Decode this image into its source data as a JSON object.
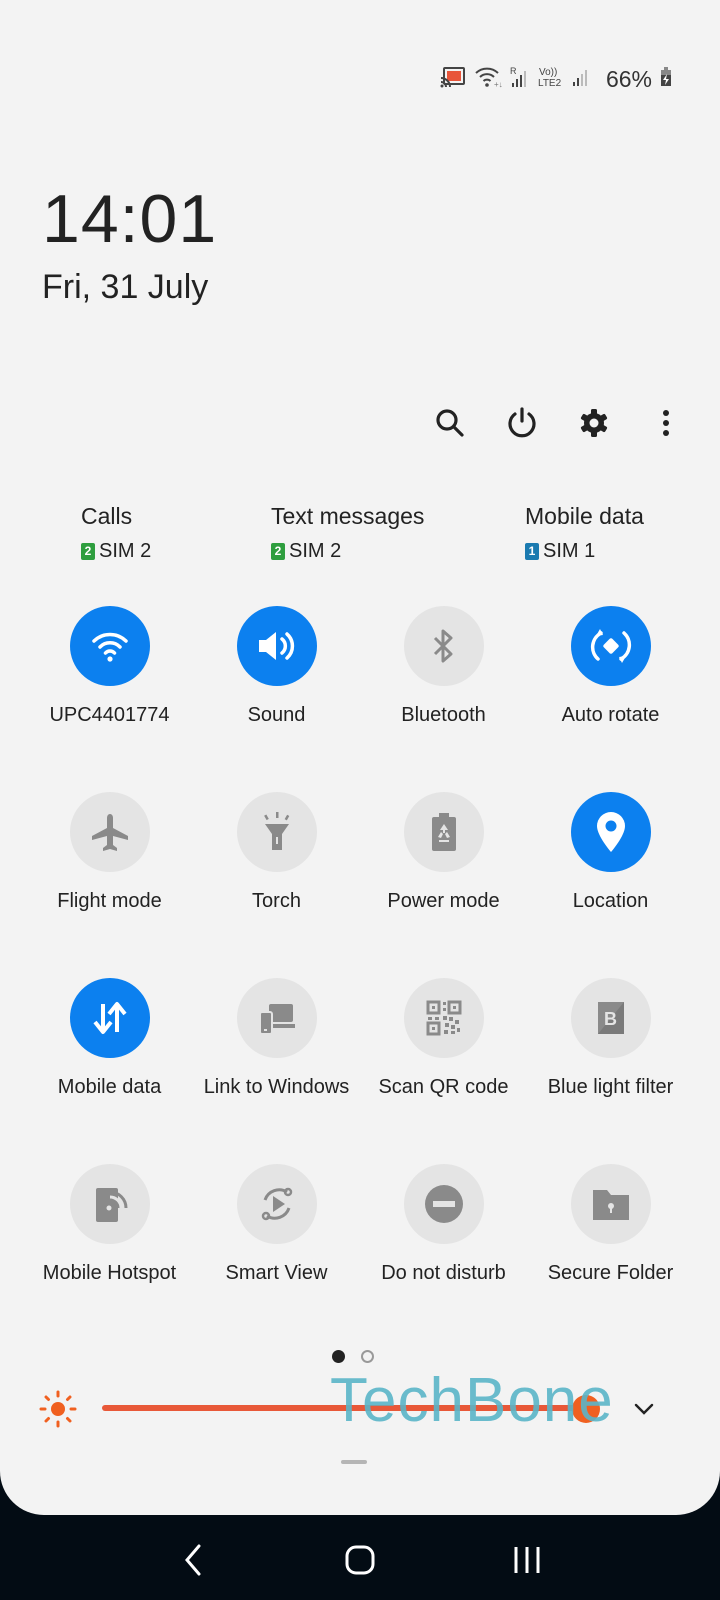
{
  "status_bar": {
    "icons": [
      "cast-icon",
      "wifi-calling-icon",
      "signal-roaming-icon",
      "volte-lte2-icon",
      "signal-icon",
      "battery-charging-icon"
    ],
    "battery_percent": "66%",
    "roaming_label": "R",
    "volte_label": "Vo))",
    "lte_label": "LTE2"
  },
  "clock": {
    "time": "14:01",
    "date": "Fri, 31 July"
  },
  "toolbar": {
    "buttons": [
      "search-icon",
      "power-icon",
      "settings-icon",
      "more-options-icon"
    ]
  },
  "sim_preferences": [
    {
      "title": "Calls",
      "sim_label": "SIM 2",
      "sim_number": "2",
      "badge_color": "#2e9e3e"
    },
    {
      "title": "Text messages",
      "sim_label": "SIM 2",
      "sim_number": "2",
      "badge_color": "#2e9e3e"
    },
    {
      "title": "Mobile data",
      "sim_label": "SIM 1",
      "sim_number": "1",
      "badge_color": "#1a7ab0"
    }
  ],
  "quick_settings": {
    "accent_color": "#0c80ef",
    "inactive_color": "#e4e4e4",
    "tiles": [
      {
        "label": "UPC4401774",
        "icon": "wifi-icon",
        "active": true
      },
      {
        "label": "Sound",
        "icon": "sound-icon",
        "active": true
      },
      {
        "label": "Bluetooth",
        "icon": "bluetooth-icon",
        "active": false
      },
      {
        "label": "Auto rotate",
        "icon": "auto-rotate-icon",
        "active": true
      },
      {
        "label": "Flight mode",
        "icon": "airplane-icon",
        "active": false
      },
      {
        "label": "Torch",
        "icon": "flashlight-icon",
        "active": false
      },
      {
        "label": "Power mode",
        "icon": "power-mode-icon",
        "active": false
      },
      {
        "label": "Location",
        "icon": "location-icon",
        "active": true
      },
      {
        "label": "Mobile data",
        "icon": "mobile-data-icon",
        "active": true
      },
      {
        "label": "Link to Windows",
        "icon": "link-to-windows-icon",
        "active": false
      },
      {
        "label": "Scan QR code",
        "icon": "qr-code-icon",
        "active": false
      },
      {
        "label": "Blue light filter",
        "icon": "blue-light-filter-icon",
        "active": false
      },
      {
        "label": "Mobile Hotspot",
        "icon": "hotspot-icon",
        "active": false
      },
      {
        "label": "Smart View",
        "icon": "smart-view-icon",
        "active": false
      },
      {
        "label": "Do not disturb",
        "icon": "do-not-disturb-icon",
        "active": false
      },
      {
        "label": "Secure Folder",
        "icon": "secure-folder-icon",
        "active": false
      }
    ]
  },
  "pager": {
    "current_page": 1,
    "total_pages": 2
  },
  "brightness": {
    "level_percent": 100,
    "color": "#e85838"
  },
  "watermark": "TechBone",
  "navbar": {
    "buttons": [
      "back-icon",
      "home-icon",
      "recents-icon"
    ]
  }
}
